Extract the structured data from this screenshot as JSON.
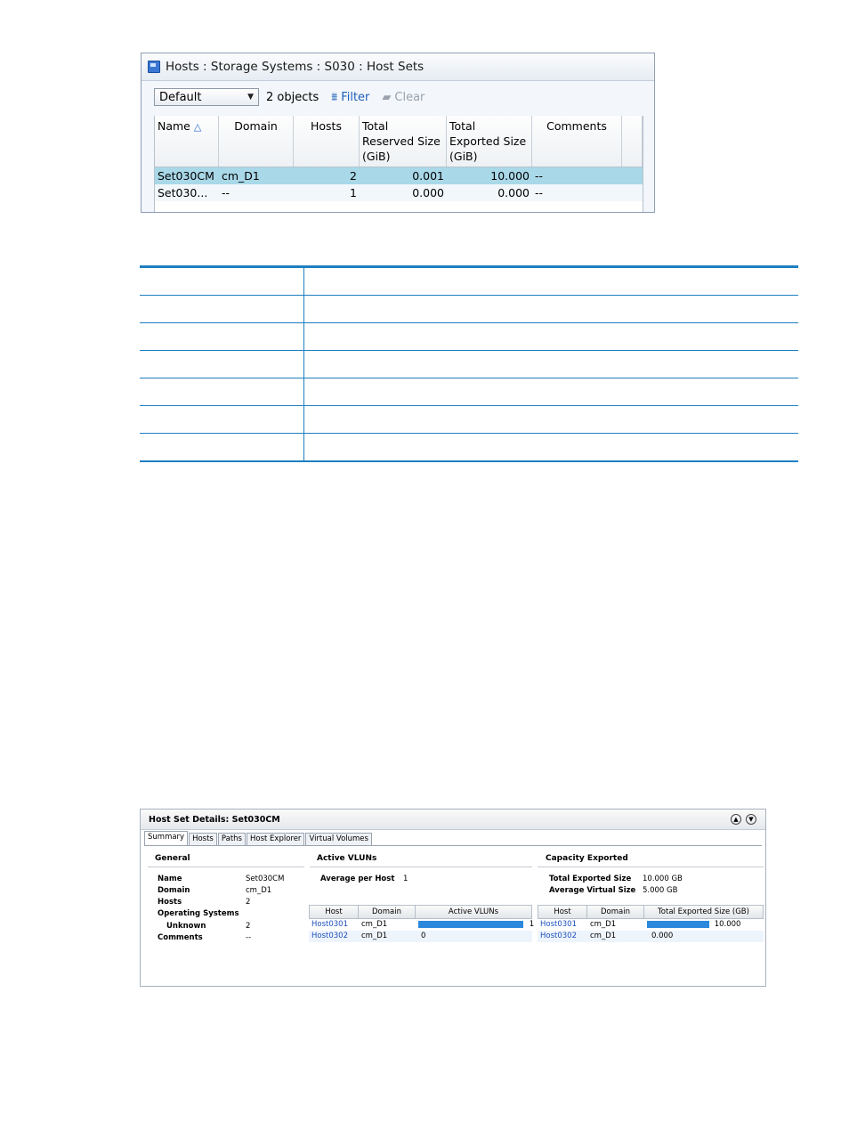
{
  "host_sets_panel": {
    "title": "Hosts : Storage Systems : S030 : Host Sets",
    "view_select": "Default",
    "object_count": "2 objects",
    "filter_label": "Filter",
    "clear_label": "Clear",
    "columns": [
      "Name",
      "Domain",
      "Hosts",
      "Total\nReserved Size\n(GiB)",
      "Total\nExported Size\n(GiB)",
      "Comments"
    ],
    "rows": [
      {
        "name": "Set030CM",
        "domain": "cm_D1",
        "hosts": "2",
        "reserved": "0.001",
        "exported": "10.000",
        "comments": "--"
      },
      {
        "name": "Set030...",
        "domain": "--",
        "hosts": "1",
        "reserved": "0.000",
        "exported": "0.000",
        "comments": "--"
      }
    ]
  },
  "details_panel": {
    "title": "Host Set Details: Set030CM",
    "tabs": [
      "Summary",
      "Hosts",
      "Paths",
      "Host Explorer",
      "Virtual Volumes"
    ],
    "general": {
      "heading": "General",
      "name_label": "Name",
      "name_value": "Set030CM",
      "domain_label": "Domain",
      "domain_value": "cm_D1",
      "hosts_label": "Hosts",
      "hosts_value": "2",
      "os_label": "Operating Systems",
      "unknown_label": "Unknown",
      "unknown_value": "2",
      "comments_label": "Comments",
      "comments_value": "--"
    },
    "active_vluns": {
      "heading": "Active VLUNs",
      "avg_label": "Average per Host",
      "avg_value": "1",
      "columns": [
        "Host",
        "Domain",
        "Active VLUNs"
      ],
      "rows": [
        {
          "host": "Host0301",
          "domain": "cm_D1",
          "value": "1",
          "fraction": 1.0
        },
        {
          "host": "Host0302",
          "domain": "cm_D1",
          "value": "0",
          "fraction": 0.0
        }
      ]
    },
    "capacity_exported": {
      "heading": "Capacity Exported",
      "total_label": "Total Exported Size",
      "total_value": "10.000 GB",
      "avg_label": "Average Virtual Size",
      "avg_value": "5.000 GB",
      "columns": [
        "Host",
        "Domain",
        "Total Exported Size (GB)"
      ],
      "rows": [
        {
          "host": "Host0301",
          "domain": "cm_D1",
          "value": "10.000",
          "fraction": 1.0
        },
        {
          "host": "Host0302",
          "domain": "cm_D1",
          "value": "0.000",
          "fraction": 0.0
        }
      ]
    }
  },
  "colors": {
    "accent": "#1e7fc0",
    "selection": "#a9d8e8",
    "bar": "#2b88dc"
  }
}
